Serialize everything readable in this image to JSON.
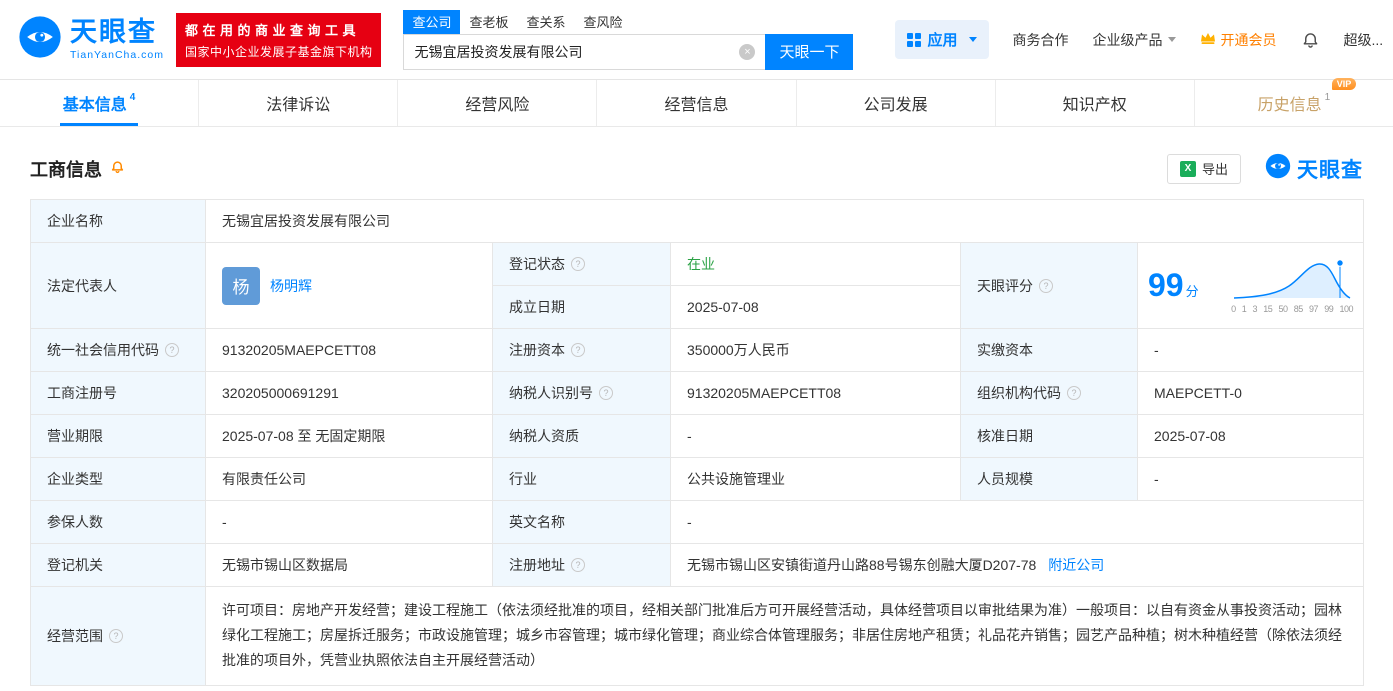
{
  "colors": {
    "brand": "#0084ff",
    "link": "#0084ff",
    "status_green": "#2ba245",
    "banner_red": "#e60012",
    "vip_orange": "#ff8a00",
    "gold": "#c8a268"
  },
  "icons": {
    "clear": "×",
    "question": "?",
    "excel": "X"
  },
  "header": {
    "logo": {
      "brand": "天眼查",
      "domain": "TianYanCha.com"
    },
    "slogan": {
      "line1": "都在用的商业查询工具",
      "line2": "国家中小企业发展子基金旗下机构"
    },
    "search": {
      "tabs": [
        {
          "label": "查公司"
        },
        {
          "label": "查老板"
        },
        {
          "label": "查关系"
        },
        {
          "label": "查风险"
        }
      ],
      "value": "无锡宜居投资发展有限公司",
      "button": "天眼一下"
    },
    "apps_label": "应用",
    "links": {
      "cooperation": "商务合作",
      "enterprise": "企业级产品",
      "vip": "开通会员",
      "super": "超级..."
    }
  },
  "tabs": [
    {
      "label": "基本信息",
      "badge": "4"
    },
    {
      "label": "法律诉讼",
      "badge": ""
    },
    {
      "label": "经营风险",
      "badge": ""
    },
    {
      "label": "经营信息",
      "badge": ""
    },
    {
      "label": "公司发展",
      "badge": ""
    },
    {
      "label": "知识产权",
      "badge": ""
    },
    {
      "label": "历史信息",
      "badge": "1",
      "vip_tag": "VIP"
    }
  ],
  "section": {
    "title": "工商信息",
    "export_label": "导出",
    "watermark_brand": "天眼查"
  },
  "info": {
    "company_name": {
      "label": "企业名称",
      "value": "无锡宜居投资发展有限公司"
    },
    "legal_rep": {
      "label": "法定代表人",
      "value": "杨明辉",
      "avatar": "杨"
    },
    "reg_status": {
      "label": "登记状态",
      "value": "在业"
    },
    "establish_date": {
      "label": "成立日期",
      "value": "2025-07-08"
    },
    "score": {
      "label": "天眼评分"
    },
    "credit_code": {
      "label": "统一社会信用代码",
      "value": "91320205MAEPCETT08"
    },
    "reg_capital": {
      "label": "注册资本",
      "value": "350000万人民币"
    },
    "paid_capital": {
      "label": "实缴资本",
      "value": "-"
    },
    "reg_number": {
      "label": "工商注册号",
      "value": "320205000691291"
    },
    "taxpayer_id": {
      "label": "纳税人识别号",
      "value": "91320205MAEPCETT08"
    },
    "org_code": {
      "label": "组织机构代码",
      "value": "MAEPCETT-0"
    },
    "business_term": {
      "label": "营业期限",
      "value": "2025-07-08 至 无固定期限"
    },
    "taxpayer_quality": {
      "label": "纳税人资质",
      "value": "-"
    },
    "approval_date": {
      "label": "核准日期",
      "value": "2025-07-08"
    },
    "company_type": {
      "label": "企业类型",
      "value": "有限责任公司"
    },
    "industry": {
      "label": "行业",
      "value": "公共设施管理业"
    },
    "staff_size": {
      "label": "人员规模",
      "value": "-"
    },
    "insured_count": {
      "label": "参保人数",
      "value": "-"
    },
    "english_name": {
      "label": "英文名称",
      "value": "-"
    },
    "reg_authority": {
      "label": "登记机关",
      "value": "无锡市锡山区数据局"
    },
    "reg_address": {
      "label": "注册地址",
      "value": "无锡市锡山区安镇街道丹山路88号锡东创融大厦D207-78",
      "link": "附近公司"
    },
    "business_scope": {
      "label": "经营范围",
      "value": "许可项目：房地产开发经营；建设工程施工（依法须经批准的项目，经相关部门批准后方可开展经营活动，具体经营项目以审批结果为准）一般项目：以自有资金从事投资活动；园林绿化工程施工；房屋拆迁服务；市政设施管理；城乡市容管理；城市绿化管理；商业综合体管理服务；非居住房地产租赁；礼品花卉销售；园艺产品种植；树木种植经营（除依法须经批准的项目外，凭营业执照依法自主开展经营活动）"
    }
  },
  "score_chart": {
    "type": "line",
    "score": "99",
    "unit": "分",
    "x_ticks": [
      "0",
      "1",
      "3",
      "15",
      "50",
      "85",
      "97",
      "99",
      "100"
    ]
  }
}
